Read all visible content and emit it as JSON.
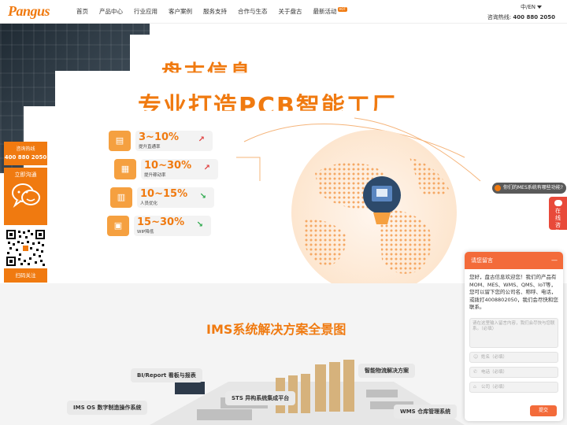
{
  "header": {
    "logo": "Pangus",
    "nav": [
      "首页",
      "产品中心",
      "行业应用",
      "客户案例",
      "服务支持",
      "合作与生态",
      "关于盘古",
      "最新活动"
    ],
    "hot_badge": "HOT",
    "lang": "中/EN",
    "hotline_label": "咨询热线:",
    "hotline_number": "400 880 2050"
  },
  "hero": {
    "title_line1": "盘古信息",
    "title_line2": "专业打造PCB智能工厂",
    "stats": [
      {
        "value": "3~10%",
        "label": "提升直通率",
        "trend": "up"
      },
      {
        "value": "10~30%",
        "label": "提升稼动率",
        "trend": "up"
      },
      {
        "value": "10~15%",
        "label": "人员优化",
        "trend": "down"
      },
      {
        "value": "15~30%",
        "label": "WIP降低",
        "trend": "down"
      }
    ]
  },
  "left_float": {
    "hotline_label": "咨询热线",
    "hotline_number": "400 880 2050",
    "chat_label": "立即沟通",
    "qr_label": "扫码关注"
  },
  "bubble": {
    "text": "你们的MES系统有哪些功能?"
  },
  "right_float": {
    "label": "在线咨询"
  },
  "section2": {
    "title": "IMS系统解决方案全景图",
    "tags": [
      "BI/Report 看板与报表",
      "智能物流解决方案",
      "STS 异构系统集成平台",
      "IMS OS 数字制造操作系统",
      "WMS 仓库管理系统"
    ]
  },
  "chat": {
    "header": "请您留言",
    "minimize": "—",
    "message": "您好，盘古信息欢迎您！我们的产品有MOM、MES、WMS、QMS、IoT等，您可以留下您的公司名、称呼、电话，或拨打4008802050，我们会尽快和您联系。",
    "textarea_placeholder": "请在这里输入留言内容，我们会尽快与您联系。（必填）",
    "name_placeholder": "姓名（必填）",
    "phone_placeholder": "电话（必填）",
    "company_placeholder": "公司（必填）",
    "submit": "提交"
  }
}
